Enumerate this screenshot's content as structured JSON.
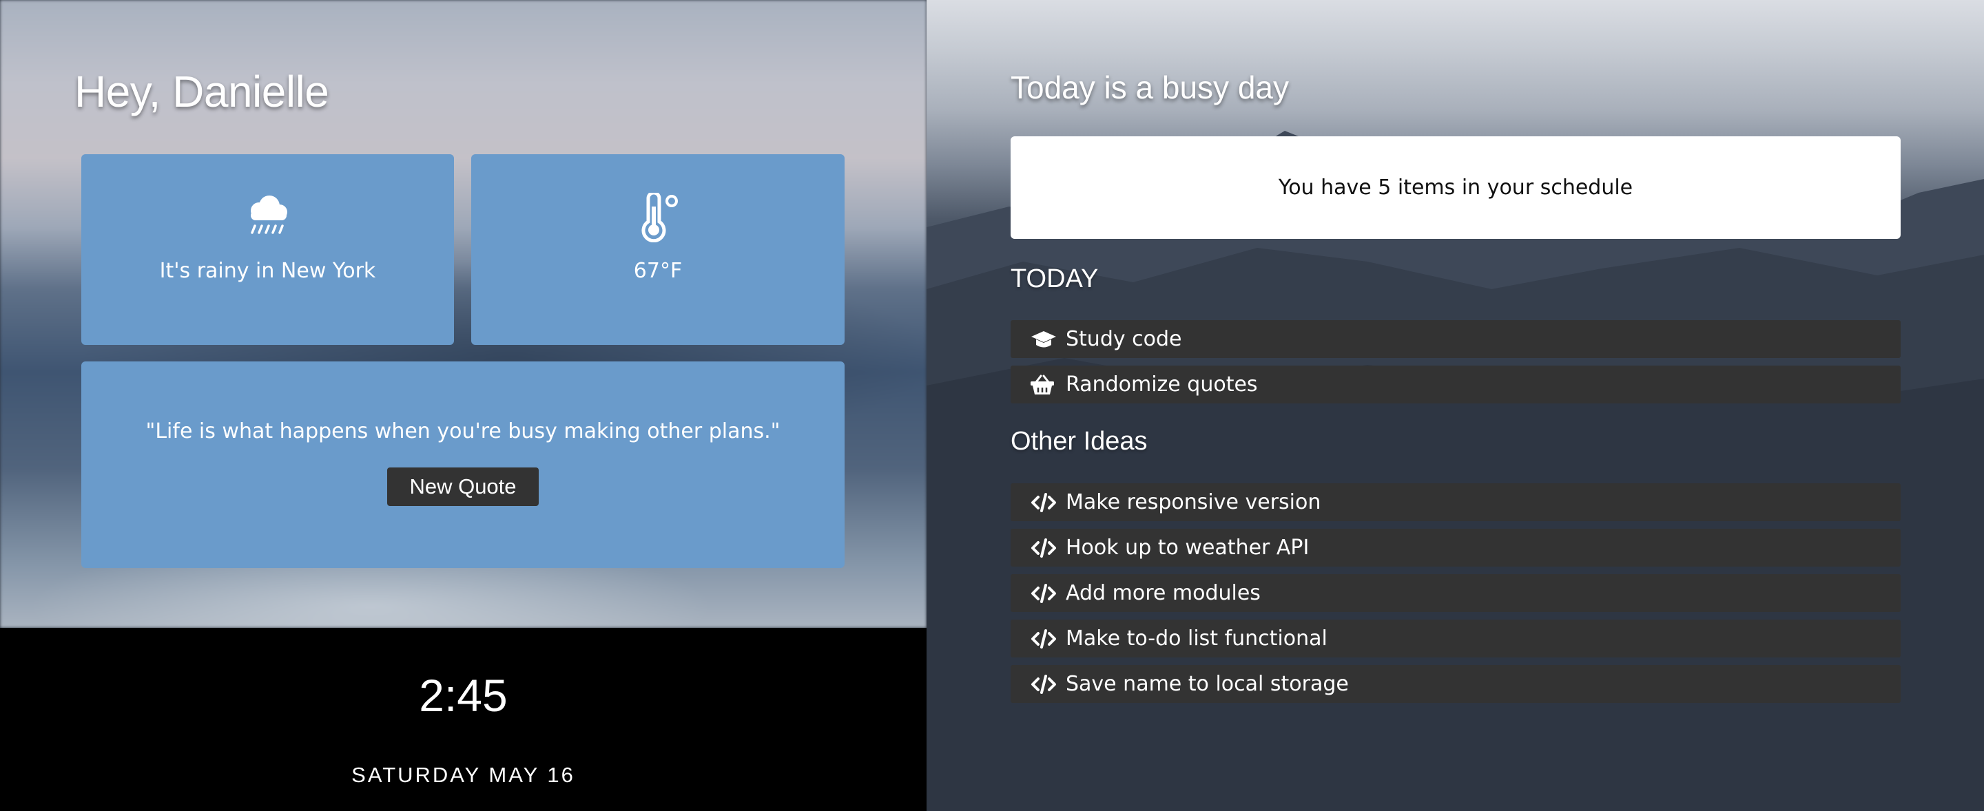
{
  "greeting": "Hey, Danielle",
  "weather": {
    "condition_text": "It's rainy in New York",
    "condition_icon": "cloud-rain-icon",
    "temperature": "67°F",
    "temperature_icon": "thermometer-icon"
  },
  "quote": {
    "text": "\"Life is what happens when you're busy making other plans.\"",
    "button_label": "New Quote"
  },
  "clock": {
    "time": "2:45",
    "date": "SATURDAY MAY 16"
  },
  "schedule": {
    "title": "Today is a busy day",
    "summary": "You have 5 items in your schedule",
    "today_heading": "TODAY",
    "today_items": [
      {
        "label": "Study code",
        "icon": "graduation-cap-icon"
      },
      {
        "label": "Randomize quotes",
        "icon": "basket-icon"
      }
    ],
    "ideas_heading": "Other Ideas",
    "idea_items": [
      {
        "label": "Make responsive version",
        "icon": "code-icon"
      },
      {
        "label": "Hook up to weather API",
        "icon": "code-icon"
      },
      {
        "label": "Add more modules",
        "icon": "code-icon"
      },
      {
        "label": "Make to-do list functional",
        "icon": "code-icon"
      },
      {
        "label": "Save name to local storage",
        "icon": "code-icon"
      }
    ]
  },
  "colors": {
    "card_blue": "#6a9bcb",
    "task_bg": "#333333",
    "clock_bg": "#000000"
  }
}
